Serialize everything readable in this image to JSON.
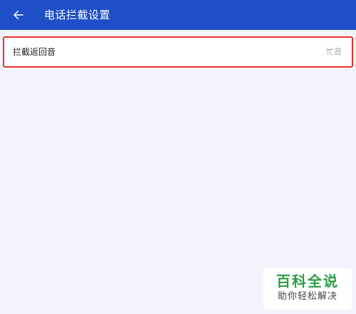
{
  "header": {
    "title": "电话拦截设置",
    "back_icon": "arrow-left-icon"
  },
  "settings": {
    "items": [
      {
        "label": "拦截返回音",
        "value": "忙音"
      }
    ]
  },
  "watermark": {
    "title": "百科全说",
    "subtitle": "助你轻松解决"
  },
  "colors": {
    "app_bar": "#1f4fc6",
    "background": "#f3f4fb",
    "highlight_border": "#e8322e",
    "watermark_green": "#2e9d45"
  }
}
